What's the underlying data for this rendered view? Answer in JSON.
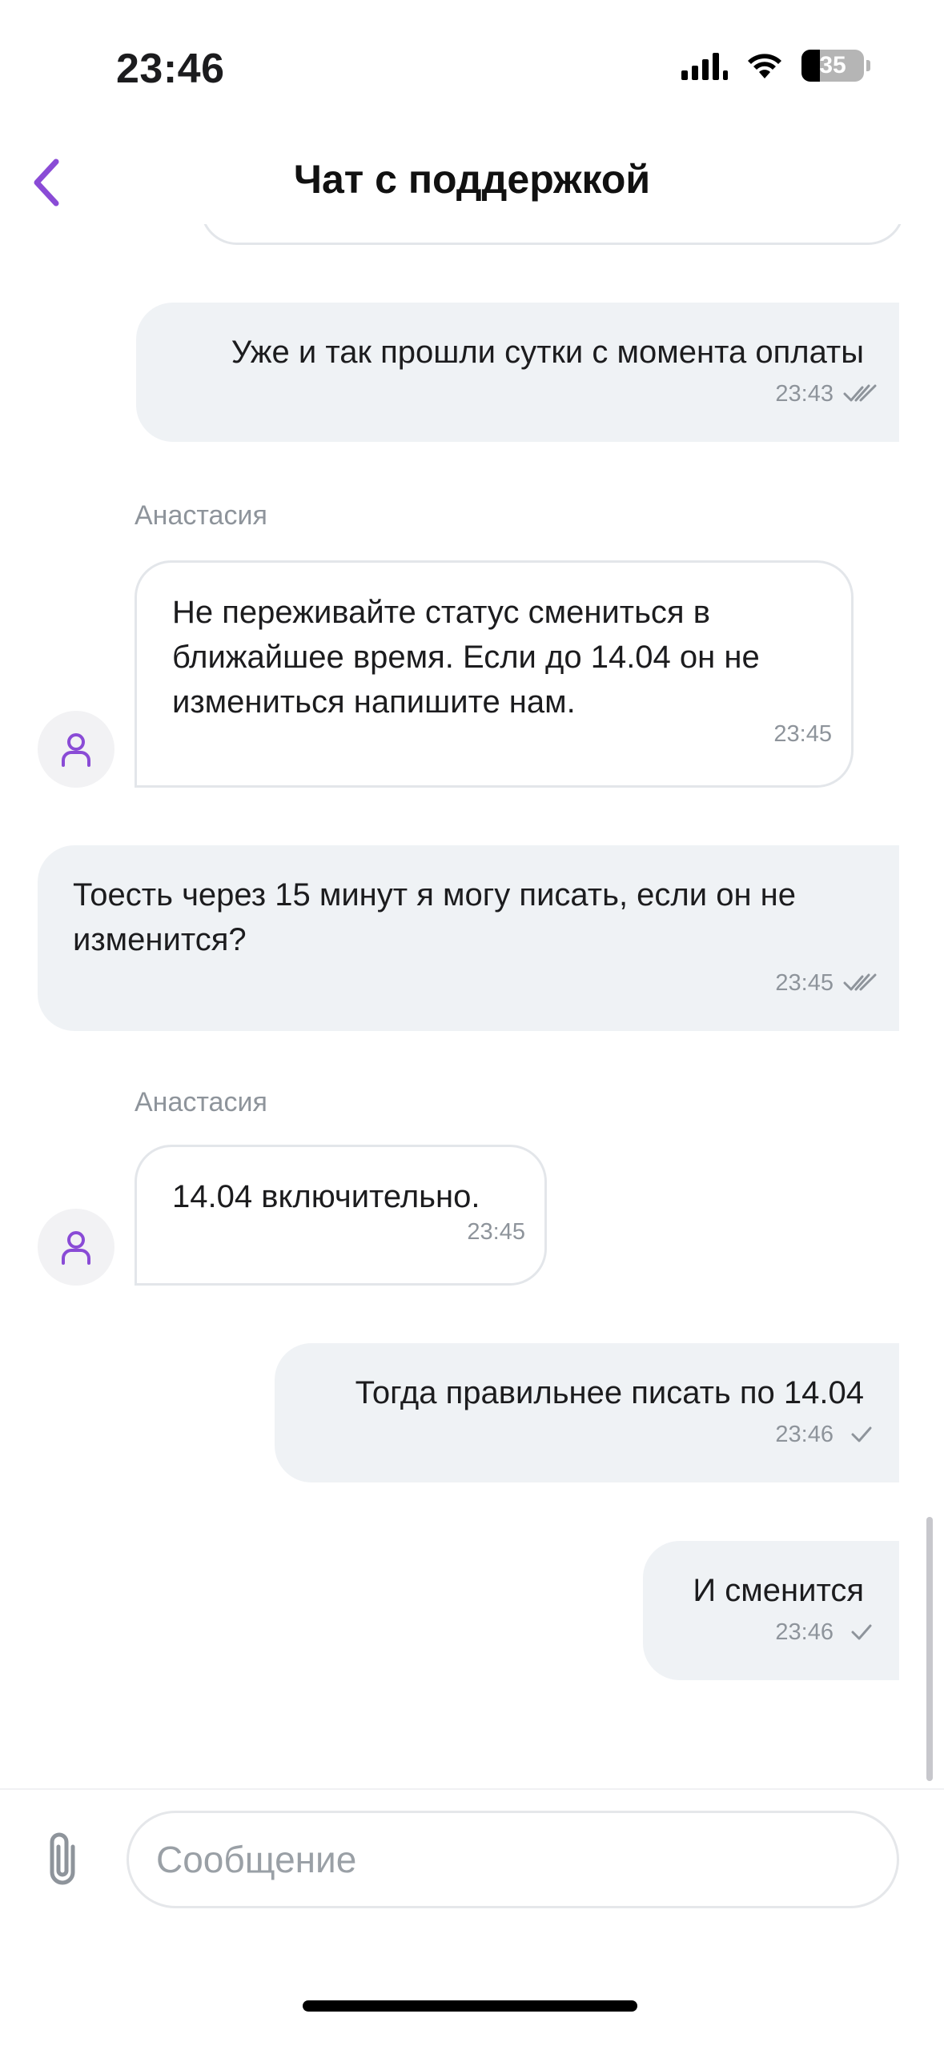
{
  "status_bar": {
    "time": "23:46",
    "battery": "35",
    "icons": [
      "cellular-signal-icon",
      "wifi-icon",
      "battery-icon"
    ]
  },
  "header": {
    "title": "Чат с поддержкой",
    "back_icon": "chevron-left-icon"
  },
  "messages": [
    {
      "direction": "outgoing",
      "text": "Уже и так прошли сутки с момента оплаты",
      "time": "23:43",
      "status": "read"
    },
    {
      "direction": "incoming",
      "sender": "Анастасия",
      "text": "Не переживайте статус смениться в ближайшее время. Если до 14.04 он не измениться напишите нам.",
      "time": "23:45"
    },
    {
      "direction": "outgoing",
      "text": "Тоесть через 15 минут я могу писать, если он не изменится?",
      "time": "23:45",
      "status": "read"
    },
    {
      "direction": "incoming",
      "sender": "Анастасия",
      "text": "14.04 включительно.",
      "time": "23:45"
    },
    {
      "direction": "outgoing",
      "text": "Тогда правильнее писать по 14.04",
      "time": "23:46",
      "status": "sent"
    },
    {
      "direction": "outgoing",
      "text": "И сменится",
      "time": "23:46",
      "status": "sent"
    }
  ],
  "composer": {
    "placeholder": "Сообщение",
    "value": "",
    "attach_icon": "paperclip-icon"
  },
  "colors": {
    "accent": "#8a4bd6",
    "outgoing_bubble": "#eff2f5",
    "incoming_border": "#e3e6ea",
    "meta_text": "#8e949b"
  }
}
